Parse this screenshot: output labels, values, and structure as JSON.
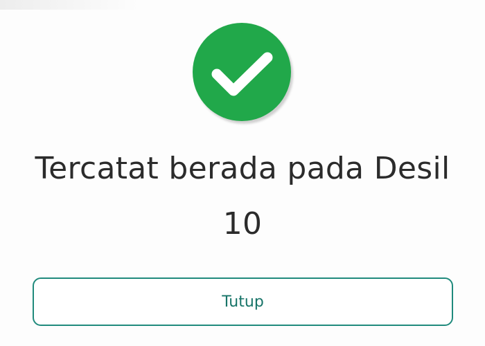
{
  "status": {
    "line1": "Tercatat berada pada Desil",
    "line2": "10",
    "icon": "check-circle-icon",
    "icon_color": "#21a84a"
  },
  "actions": {
    "close_label": "Tutup",
    "accent_color": "#1f8a7c"
  }
}
